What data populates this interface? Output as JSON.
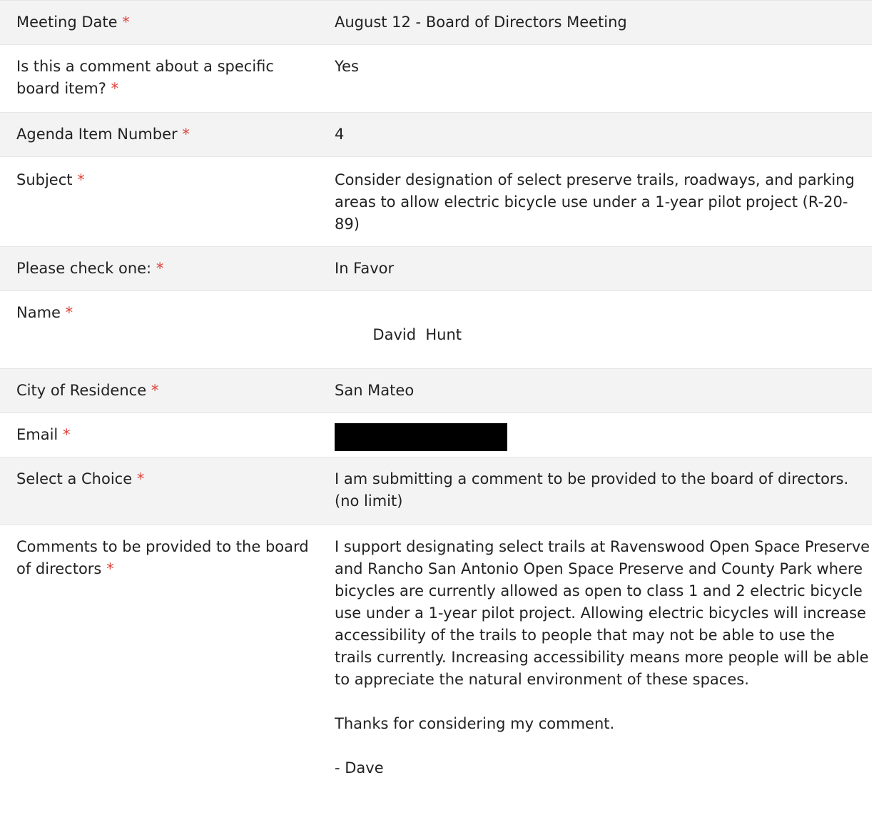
{
  "required_marker": "*",
  "rows": [
    {
      "label": "Meeting Date",
      "value": "August 12 - Board of Directors Meeting"
    },
    {
      "label": "Is this a comment about a specific board item?",
      "value": "Yes"
    },
    {
      "label": "Agenda Item Number",
      "value": "4"
    },
    {
      "label": "Subject",
      "value": "Consider designation of select preserve trails, roadways, and parking areas to allow electric bicycle use under a 1-year pilot project (R-20-89)"
    },
    {
      "label": "Please check one:",
      "value": "In Favor"
    },
    {
      "label": "Name",
      "value": "David  Hunt"
    },
    {
      "label": "City of Residence",
      "value": "San Mateo"
    },
    {
      "label": "Email",
      "value": ""
    },
    {
      "label": "Select a Choice",
      "value": "I am submitting a comment to be provided to the board of directors. (no limit)"
    },
    {
      "label": "Comments to be provided to the board of directors",
      "paragraphs": [
        "I support designating select trails at Ravenswood Open Space Preserve and Rancho San Antonio Open Space Preserve and County Park where bicycles are currently allowed as open to class 1 and 2 electric bicycle use under a 1-year pilot project. Allowing electric bicycles will increase accessibility of the trails to people that may not be able to use the trails currently. Increasing accessibility means more people will be able to appreciate the natural environment of these spaces.",
        "Thanks for considering my comment.",
        "- Dave"
      ]
    }
  ]
}
